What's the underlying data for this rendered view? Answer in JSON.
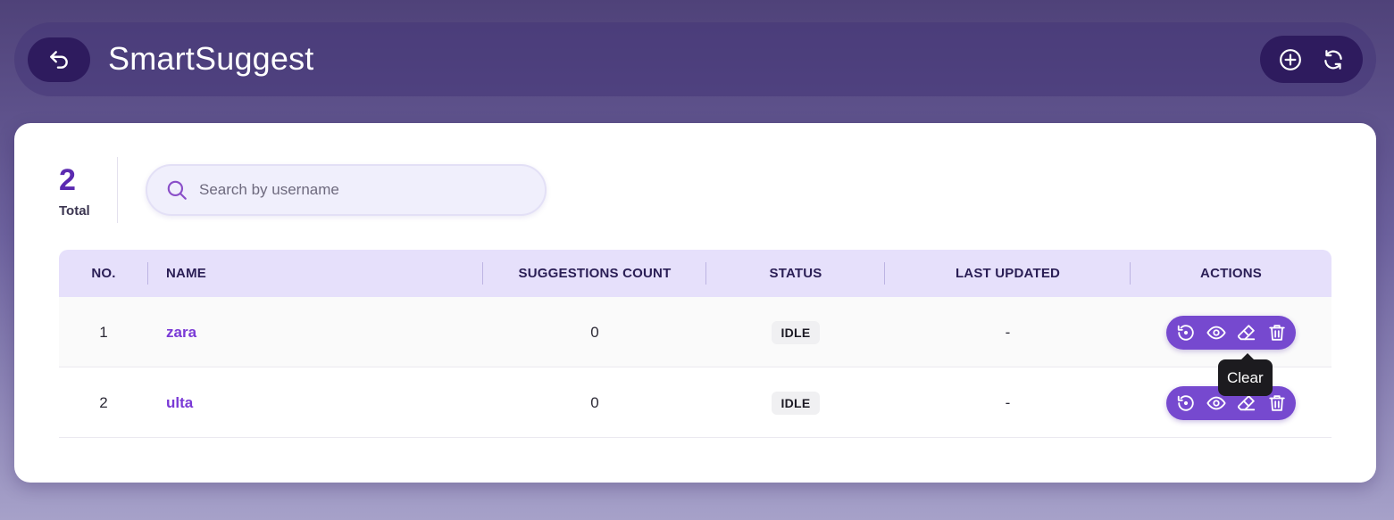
{
  "header": {
    "title": "SmartSuggest",
    "back_icon": "undo-arrow-icon",
    "actions": [
      {
        "name": "add-button",
        "icon": "plus-circle-icon"
      },
      {
        "name": "refresh-button",
        "icon": "refresh-icon"
      }
    ]
  },
  "summary": {
    "total_value": "2",
    "total_label": "Total"
  },
  "search": {
    "placeholder": "Search by username",
    "value": ""
  },
  "table": {
    "columns": [
      "NO.",
      "NAME",
      "SUGGESTIONS COUNT",
      "STATUS",
      "LAST UPDATED",
      "ACTIONS"
    ],
    "rows": [
      {
        "no": "1",
        "name": "zara",
        "count": "0",
        "status": "IDLE",
        "updated": "-"
      },
      {
        "no": "2",
        "name": "ulta",
        "count": "0",
        "status": "IDLE",
        "updated": "-"
      }
    ],
    "row_actions": [
      "history-icon",
      "eye-icon",
      "eraser-icon",
      "trash-icon"
    ]
  },
  "tooltip": {
    "text": "Clear"
  },
  "colors": {
    "accent": "#7649cf",
    "dark": "#2e1b5e",
    "header_bg": "#e6e0fb",
    "link": "#7a3ad6"
  }
}
